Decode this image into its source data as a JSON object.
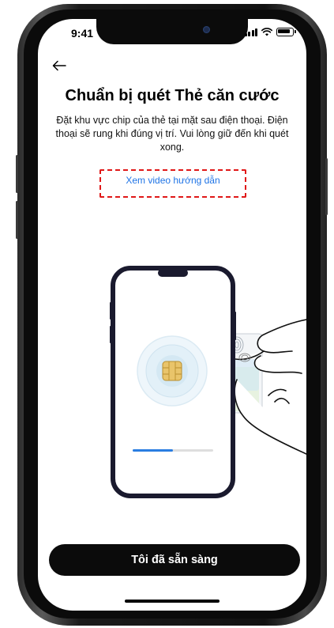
{
  "status_bar": {
    "time": "9:41"
  },
  "header": {
    "back_icon": "arrow-left-icon"
  },
  "main": {
    "title": "Chuẩn bị quét Thẻ căn cước",
    "description": "Đặt khu vực chip của thẻ tại mặt sau điện thoại. Điện thoại sẽ rung khi đúng vị trí. Vui lòng giữ đến khi quét xong.",
    "video_link": "Xem video hướng dẫn",
    "scan_progress": 0.5
  },
  "footer": {
    "cta_label": "Tôi đã sẵn sàng"
  },
  "colors": {
    "link": "#1f74e6",
    "cta_bg": "#0b0b0b",
    "highlight_dashed": "#e01818",
    "progress": "#2a7de1"
  }
}
